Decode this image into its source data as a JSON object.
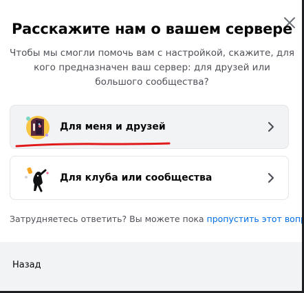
{
  "modal": {
    "title": "Расскажите нам о вашем сервере",
    "subtitle": "Чтобы мы смогли помочь вам с настройкой, скажите, для кого предназначен ваш сервер: для друзей или большого сообщества?",
    "options": [
      {
        "label": "Для меня и друзей",
        "icon": "friends-illustration-icon",
        "hovered": true
      },
      {
        "label": "Для клуба или сообщества",
        "icon": "community-illustration-icon",
        "hovered": false
      }
    ],
    "hint": {
      "text": "Затрудняетесь ответить? Вы можете пока ",
      "link": "пропустить этот вопрос",
      "suffix": "."
    },
    "footer": {
      "back_label": "Назад"
    }
  },
  "colors": {
    "title": "#060607",
    "text": "#4e5058",
    "link": "#006ce7",
    "footer_bg": "#f2f3f5",
    "annotation": "#e0191b"
  }
}
